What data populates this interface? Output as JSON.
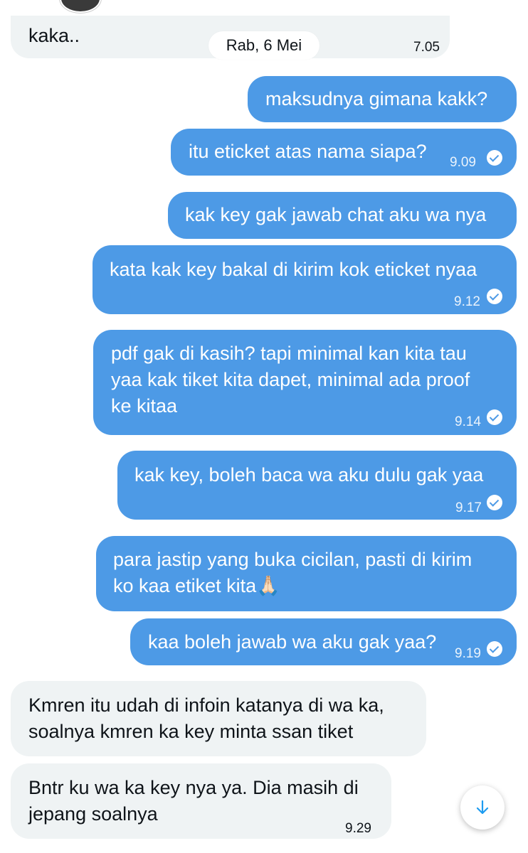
{
  "date_separator": "Rab, 6 Mei",
  "messages": [
    {
      "side": "in",
      "text": "kaka..",
      "time": "7.05"
    },
    {
      "side": "out",
      "text": "maksudnya gimana kakk?",
      "time": ""
    },
    {
      "side": "out",
      "text": "itu eticket atas nama siapa?",
      "time": "9.09",
      "read": true
    },
    {
      "side": "out",
      "text": "kak key gak jawab chat aku wa nya",
      "time": ""
    },
    {
      "side": "out",
      "text": "kata kak key bakal di kirim kok eticket nyaa",
      "time": "9.12",
      "read": true
    },
    {
      "side": "out",
      "lines": [
        "pdf gak di kasih? tapi minimal kan kita tau",
        "yaa kak tiket kita dapet, minimal ada proof",
        "ke kitaa"
      ],
      "time": "9.14",
      "read": true
    },
    {
      "side": "out",
      "text": "kak key, boleh baca wa aku dulu gak yaa",
      "time": "9.17",
      "read": true
    },
    {
      "side": "out",
      "lines": [
        "para jastip yang buka cicilan, pasti di kirim",
        "ko kaa etiket kita🙏🏻"
      ],
      "time": ""
    },
    {
      "side": "out",
      "text": "kaa boleh jawab wa aku gak yaa?",
      "time": "9.19",
      "read": true
    },
    {
      "side": "in",
      "lines": [
        "Kmren itu udah di infoin katanya di wa ka,",
        "soalnya kmren ka key minta ssan tiket"
      ],
      "time": ""
    },
    {
      "side": "in",
      "lines": [
        "Bntr ku wa ka key nya ya. Dia masih di",
        "jepang soalnya"
      ],
      "time": "9.29"
    }
  ],
  "icons": {
    "read_receipt": "check-circle-icon",
    "scroll_down": "arrow-down-icon"
  },
  "colors": {
    "outgoing_bubble": "#4d9ae6",
    "incoming_bubble": "#eff3f4",
    "accent": "#1d9bf0"
  }
}
